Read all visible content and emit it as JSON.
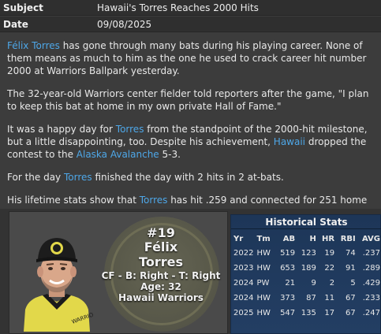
{
  "message": {
    "subject_label": "Subject",
    "subject": "Hawaii's Torres Reaches 2000 Hits",
    "date_label": "Date",
    "date": "09/08/2025"
  },
  "article": {
    "p1": {
      "link": "Félix Torres",
      "text": " has gone through many bats during his playing career. None of them means as much to him as the one he used to crack career hit number 2000 at Warriors Ballpark yesterday."
    },
    "p2": "The 32-year-old Warriors center fielder told reporters after the game, \"I plan to keep this bat at home in my own private Hall of Fame.\"",
    "p3": {
      "t1": "It was a happy day for ",
      "l1": "Torres",
      "t2": " from the standpoint of the 2000-hit milestone, but a little disappointing, too. Despite his achievement, ",
      "l2": "Hawaii",
      "t3": " dropped the contest to the ",
      "l3": "Alaska Avalanche",
      "t4": " 5-3."
    },
    "p4": {
      "t1": "For the day ",
      "l1": "Torres",
      "t2": " finished the day with 2 hits in 2 at-bats."
    },
    "p5": {
      "t1": "His lifetime stats show that ",
      "l1": "Torres",
      "t2": " has hit .259 and connected for 251 home runs."
    }
  },
  "player": {
    "number": "#19",
    "first_name": "Félix",
    "last_name": "Torres",
    "position_line": "CF - B: Right - T: Right",
    "age_line": "Age: 32",
    "team": "Hawaii Warriors"
  },
  "stats": {
    "title": "Historical Stats",
    "headers": [
      "Yr",
      "Tm",
      "AB",
      "H",
      "HR",
      "RBI",
      "AVG"
    ],
    "rows": [
      [
        "2022",
        "HW",
        "519",
        "123",
        "19",
        "74",
        ".237"
      ],
      [
        "2023",
        "HW",
        "653",
        "189",
        "22",
        "91",
        ".289"
      ],
      [
        "2024",
        "PW",
        "21",
        "9",
        "2",
        "5",
        ".429"
      ],
      [
        "2024",
        "HW",
        "373",
        "87",
        "11",
        "67",
        ".233"
      ],
      [
        "2025",
        "HW",
        "547",
        "135",
        "17",
        "67",
        ".247"
      ]
    ]
  },
  "colors": {
    "link": "#4ea7e8",
    "stats_bg": "#1d3658",
    "jersey": "#e2d84a"
  },
  "icons": {
    "team_logo": "warriors-logo-icon",
    "cap_logo": "cap-logo-icon"
  }
}
